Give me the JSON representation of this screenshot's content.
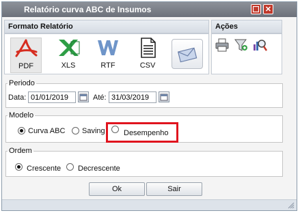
{
  "window": {
    "title": "Relatório curva ABC de Insumos"
  },
  "formato": {
    "header": "Formato Relatório",
    "items": [
      {
        "label": "PDF",
        "icon": "pdf-icon"
      },
      {
        "label": "XLS",
        "icon": "xls-icon"
      },
      {
        "label": "RTF",
        "icon": "rtf-icon"
      },
      {
        "label": "CSV",
        "icon": "csv-icon"
      },
      {
        "label": "",
        "icon": "email-icon"
      }
    ]
  },
  "acoes": {
    "header": "Ações",
    "icons": [
      "printer-icon",
      "filter-icon",
      "search-report-icon"
    ]
  },
  "periodo": {
    "legend": "Periodo",
    "data_label": "Data:",
    "data_value": "01/01/2019",
    "ate_label": "Até:",
    "ate_value": "31/03/2019"
  },
  "modelo": {
    "legend": "Modelo",
    "options": [
      "Curva ABC",
      "Saving",
      "Desempenho"
    ],
    "selected": "Curva ABC",
    "highlight_color": "#e0141e"
  },
  "ordem": {
    "legend": "Ordem",
    "options": [
      "Crescente",
      "Decrescente"
    ],
    "selected": "Crescente"
  },
  "buttons": {
    "ok": "Ok",
    "sair": "Sair"
  }
}
